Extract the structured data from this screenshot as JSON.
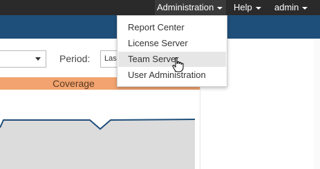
{
  "topnav": {
    "administration": "Administration",
    "help": "Help",
    "user": "admin"
  },
  "admin_menu": {
    "items": [
      {
        "label": "Report Center"
      },
      {
        "label": "License Server"
      },
      {
        "label": "Team Server"
      },
      {
        "label": "User Administration"
      }
    ],
    "hovered": "Team Server"
  },
  "filters": {
    "period_label": "Period:",
    "period_value": "Las"
  },
  "coverage": {
    "label": "Coverage"
  },
  "colors": {
    "topbar": "#2a2a2a",
    "brand_bar": "#1e4f7a",
    "coverage_header": "#f2a36f",
    "chart_line": "#1f4e79",
    "chart_fill": "#dcdcdc"
  }
}
